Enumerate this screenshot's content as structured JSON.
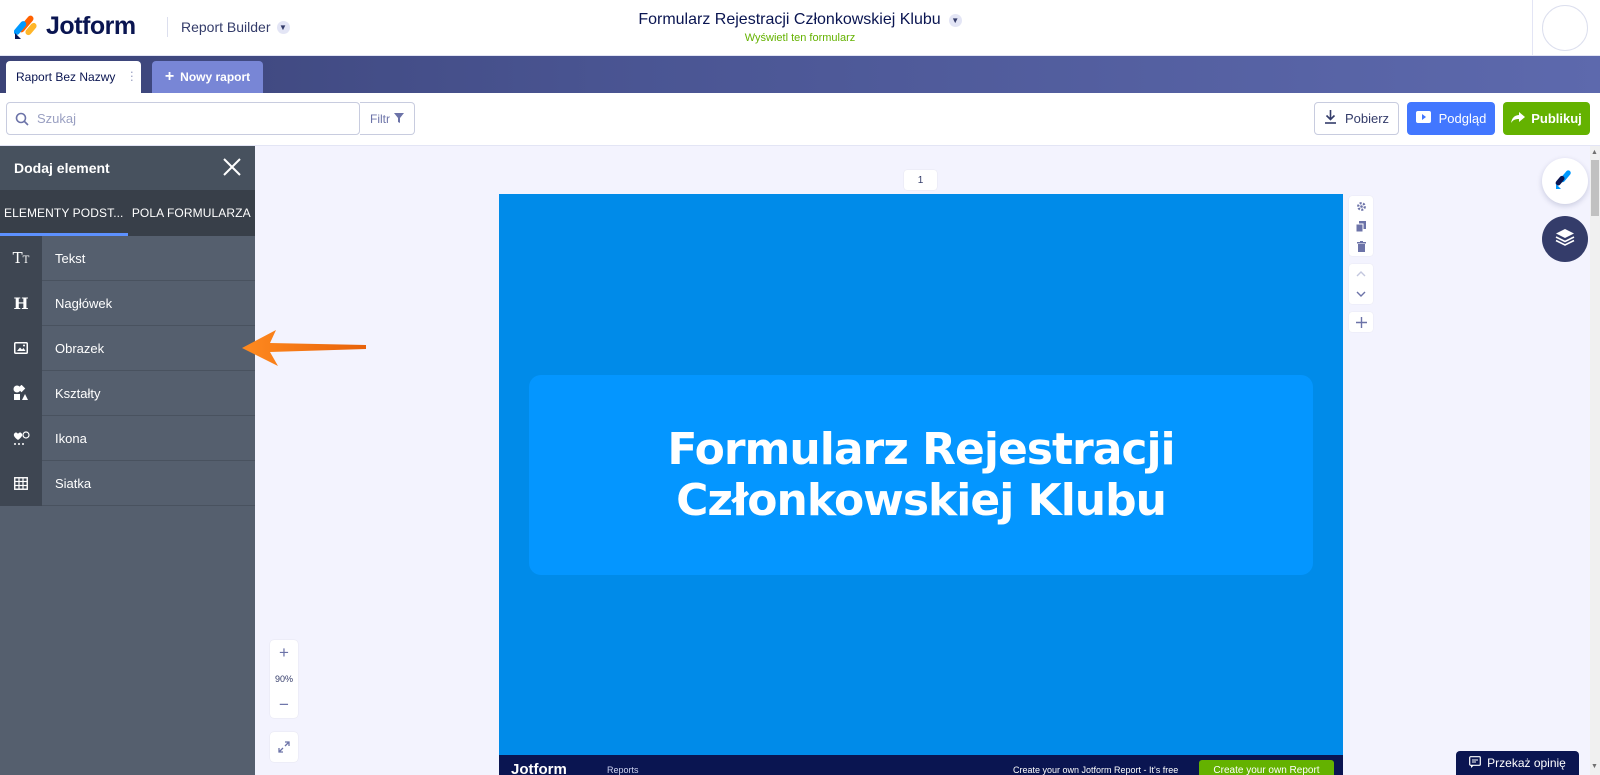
{
  "header": {
    "logo_text": "Jotform",
    "builder_label": "Report Builder",
    "form_title": "Formularz Rejestracji Członkowskiej Klubu",
    "form_subtitle": "Wyświetl ten formularz"
  },
  "tabs": {
    "active_label": "Raport Bez Nazwy",
    "new_label": "Nowy raport"
  },
  "toolbar": {
    "search_placeholder": "Szukaj",
    "filter_label": "Filtr",
    "download_label": "Pobierz",
    "preview_label": "Podgląd",
    "publish_label": "Publikuj"
  },
  "sidebar": {
    "title": "Dodaj element",
    "tabs": [
      {
        "label": "ELEMENTY PODST..."
      },
      {
        "label": "POLA FORMULARZA"
      }
    ],
    "items": [
      {
        "label": "Tekst",
        "icon": "text-icon"
      },
      {
        "label": "Nagłówek",
        "icon": "heading-icon"
      },
      {
        "label": "Obrazek",
        "icon": "image-icon"
      },
      {
        "label": "Kształty",
        "icon": "shapes-icon"
      },
      {
        "label": "Ikona",
        "icon": "icons-icon"
      },
      {
        "label": "Siatka",
        "icon": "grid-icon"
      }
    ]
  },
  "canvas": {
    "page_number": "1",
    "title": "Formularz Rejestracji Członkowskiej Klubu",
    "footer": {
      "logo": "Jotform",
      "reports": "Reports",
      "tagline": "Create your own Jotform Report - It's free",
      "button": "Create your own Report"
    },
    "zoom": "90%"
  },
  "feedback_label": "Przekaż opinię",
  "colors": {
    "brand_navy": "#0a1551",
    "page_blue": "#008be9",
    "title_box_blue": "#0496ff",
    "preview_blue": "#4277ff",
    "publish_green": "#64b200",
    "sidebar_bg": "#555f6e",
    "annotation_arrow": "#f47a1f"
  }
}
